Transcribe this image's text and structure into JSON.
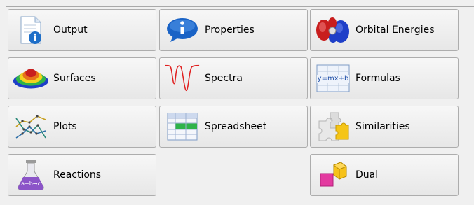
{
  "buttons": {
    "output": {
      "label": "Output",
      "icon": "document-info-icon"
    },
    "properties": {
      "label": "Properties",
      "icon": "info-icon"
    },
    "orbital_energies": {
      "label": "Orbital Energies",
      "icon": "orbital-icon"
    },
    "surfaces": {
      "label": "Surfaces",
      "icon": "surface-icon"
    },
    "spectra": {
      "label": "Spectra",
      "icon": "spectrum-icon"
    },
    "formulas": {
      "label": "Formulas",
      "icon": "formula-icon",
      "icon_text": "y=mx+b"
    },
    "plots": {
      "label": "Plots",
      "icon": "plot-icon"
    },
    "spreadsheet": {
      "label": "Spreadsheet",
      "icon": "spreadsheet-icon"
    },
    "similarities": {
      "label": "Similarities",
      "icon": "puzzle-icon"
    },
    "reactions": {
      "label": "Reactions",
      "icon": "flask-icon",
      "icon_text": "a+b→c"
    },
    "dual": {
      "label": "Dual",
      "icon": "dual-icon"
    }
  },
  "colors": {
    "accent_blue": "#1f6fc8",
    "red": "#c81e1e",
    "green": "#2fb34a"
  }
}
